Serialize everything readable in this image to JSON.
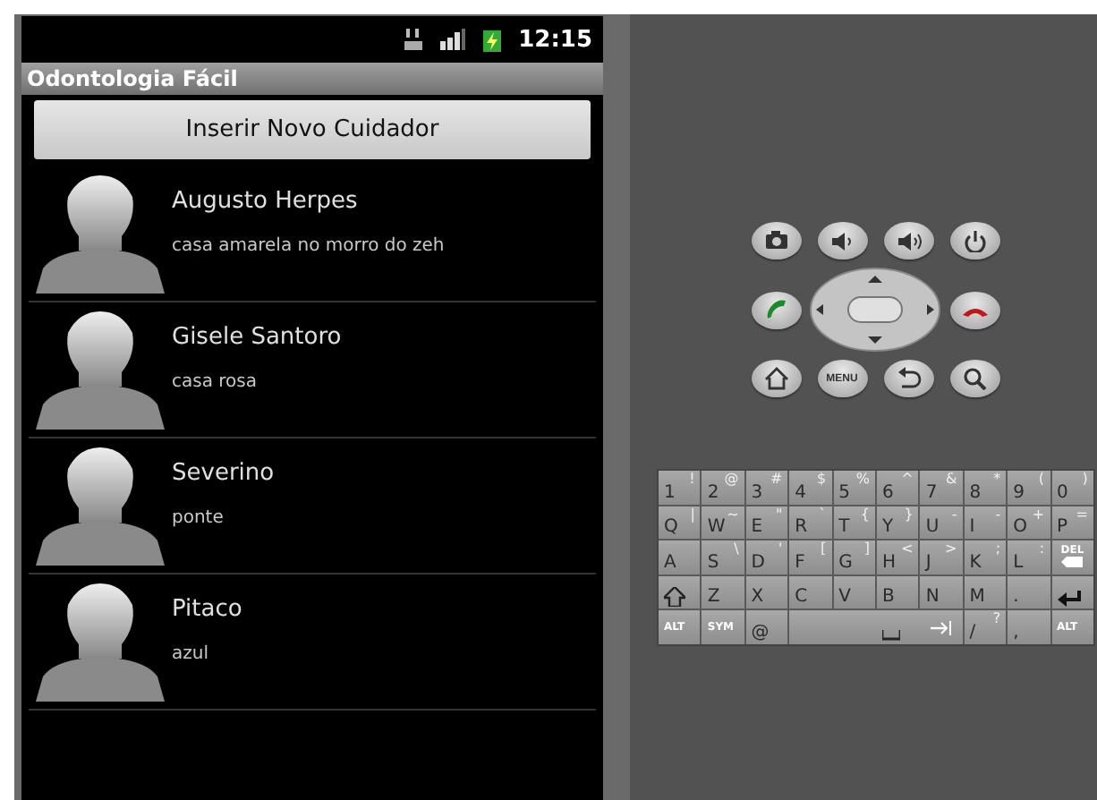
{
  "status_bar": {
    "time": "12:15"
  },
  "app": {
    "title": "Odontologia Fácil",
    "button": "Inserir Novo Cuidador",
    "contacts": [
      {
        "name": "Augusto Herpes",
        "address": "casa amarela no morro do zeh"
      },
      {
        "name": "Gisele Santoro",
        "address": "casa rosa"
      },
      {
        "name": "Severino",
        "address": "ponte"
      },
      {
        "name": "Pitaco",
        "address": "azul"
      }
    ]
  },
  "controls": [
    {
      "kind": "camera"
    },
    {
      "kind": "volume-down"
    },
    {
      "kind": "volume-up"
    },
    {
      "kind": "power"
    },
    {
      "kind": "call"
    },
    {
      "kind": "dpad"
    },
    {
      "kind": "end-call"
    },
    {
      "kind": "home"
    },
    {
      "kind": "menu",
      "label": "MENU"
    },
    {
      "kind": "back"
    },
    {
      "kind": "search"
    }
  ],
  "keyboard": {
    "rows": [
      [
        {
          "kind": "char",
          "label": "1",
          "alt": "!"
        },
        {
          "kind": "char",
          "label": "2",
          "alt": "@"
        },
        {
          "kind": "char",
          "label": "3",
          "alt": "#"
        },
        {
          "kind": "char",
          "label": "4",
          "alt": "$"
        },
        {
          "kind": "char",
          "label": "5",
          "alt": "%"
        },
        {
          "kind": "char",
          "label": "6",
          "alt": "^"
        },
        {
          "kind": "char",
          "label": "7",
          "alt": "&"
        },
        {
          "kind": "char",
          "label": "8",
          "alt": "*"
        },
        {
          "kind": "char",
          "label": "9",
          "alt": "("
        },
        {
          "kind": "char",
          "label": "0",
          "alt": ")"
        }
      ],
      [
        {
          "kind": "char",
          "label": "Q",
          "alt": "|"
        },
        {
          "kind": "char",
          "label": "W",
          "alt": "~"
        },
        {
          "kind": "char",
          "label": "E",
          "alt": "\""
        },
        {
          "kind": "char",
          "label": "R",
          "alt": "`"
        },
        {
          "kind": "char",
          "label": "T",
          "alt": "{"
        },
        {
          "kind": "char",
          "label": "Y",
          "alt": "}"
        },
        {
          "kind": "char",
          "label": "U",
          "alt": "-"
        },
        {
          "kind": "char",
          "label": "I",
          "alt": "-"
        },
        {
          "kind": "char",
          "label": "O",
          "alt": "+"
        },
        {
          "kind": "char",
          "label": "P",
          "alt": "="
        }
      ],
      [
        {
          "kind": "char",
          "label": "A"
        },
        {
          "kind": "char",
          "label": "S",
          "alt": "\\"
        },
        {
          "kind": "char",
          "label": "D",
          "alt": "'"
        },
        {
          "kind": "char",
          "label": "F",
          "alt": "["
        },
        {
          "kind": "char",
          "label": "G",
          "alt": "]"
        },
        {
          "kind": "char",
          "label": "H",
          "alt": "<"
        },
        {
          "kind": "char",
          "label": "J",
          "alt": ">"
        },
        {
          "kind": "char",
          "label": "K",
          "alt": ";"
        },
        {
          "kind": "char",
          "label": "L",
          "alt": ":"
        },
        {
          "kind": "del",
          "label": "DEL"
        }
      ],
      [
        {
          "kind": "shift"
        },
        {
          "kind": "char",
          "label": "Z"
        },
        {
          "kind": "char",
          "label": "X"
        },
        {
          "kind": "char",
          "label": "C"
        },
        {
          "kind": "char",
          "label": "V"
        },
        {
          "kind": "char",
          "label": "B"
        },
        {
          "kind": "char",
          "label": "N"
        },
        {
          "kind": "char",
          "label": "M"
        },
        {
          "kind": "char",
          "label": "."
        },
        {
          "kind": "enter"
        }
      ]
    ],
    "bottom_row": [
      {
        "kind": "small",
        "label": "ALT"
      },
      {
        "kind": "small",
        "label": "SYM"
      },
      {
        "kind": "char",
        "label": "@"
      },
      {
        "kind": "space"
      },
      {
        "kind": "char",
        "label": "/",
        "alt": "?"
      },
      {
        "kind": "char",
        "label": ","
      },
      {
        "kind": "small",
        "label": "ALT"
      }
    ]
  }
}
